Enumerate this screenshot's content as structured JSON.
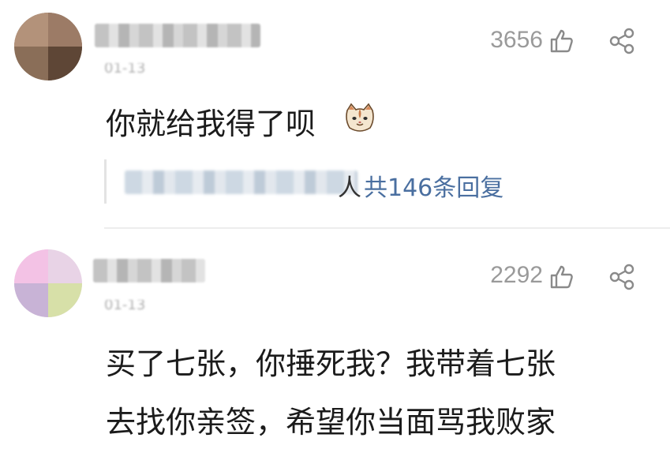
{
  "comments": [
    {
      "likes": "3656",
      "text": "你就给我得了呗",
      "emoji": "cat-face-emoji",
      "reply_tail": "人",
      "reply_count": "共146条回复"
    },
    {
      "likes": "2292",
      "text_lines": [
        "买了七张，你捶死我？我带着七张",
        "去找你亲签，希望你当面骂我败家"
      ]
    }
  ],
  "colors": {
    "like_gray": "#9a9a9a",
    "reply_link": "#4a6fa0",
    "divider": "#ededed"
  }
}
